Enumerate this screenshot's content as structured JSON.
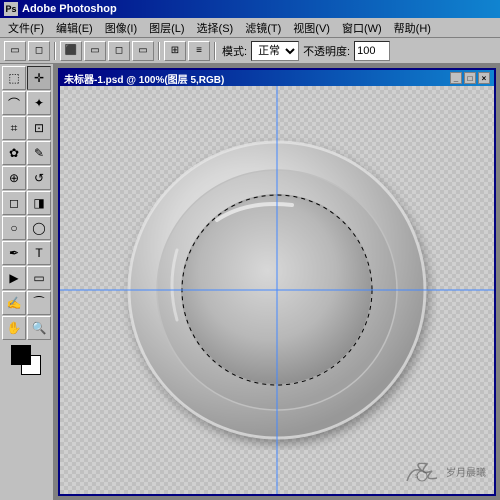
{
  "app": {
    "title": "Adobe Photoshop",
    "icon": "ps"
  },
  "menu": {
    "items": [
      "文件(F)",
      "编辑(E)",
      "图像(I)",
      "图层(L)",
      "选择(S)",
      "滤镜(T)",
      "视图(V)",
      "窗口(W)",
      "帮助(H)"
    ]
  },
  "toolbar": {
    "mode_label": "模式:",
    "mode_value": "正常",
    "opacity_label": "不透明度:",
    "opacity_value": "100"
  },
  "doc": {
    "title": "未标器-1.psd @ 100%(图层 5,RGB)",
    "close": "×",
    "minimize": "_",
    "restore": "□"
  },
  "tools": [
    {
      "name": "rectangular-marquee",
      "icon": "⬚"
    },
    {
      "name": "move",
      "icon": "✛"
    },
    {
      "name": "lasso",
      "icon": "⌒"
    },
    {
      "name": "polygon-lasso",
      "icon": "⬟"
    },
    {
      "name": "magic-wand",
      "icon": "✦"
    },
    {
      "name": "crop",
      "icon": "⌗"
    },
    {
      "name": "slice",
      "icon": "⊡"
    },
    {
      "name": "healing-brush",
      "icon": "✿"
    },
    {
      "name": "brush",
      "icon": "✎"
    },
    {
      "name": "clone-stamp",
      "icon": "⊕"
    },
    {
      "name": "history-brush",
      "icon": "↺"
    },
    {
      "name": "eraser",
      "icon": "◻"
    },
    {
      "name": "gradient",
      "icon": "◨"
    },
    {
      "name": "blur",
      "icon": "○"
    },
    {
      "name": "dodge",
      "icon": "◯"
    },
    {
      "name": "pen",
      "icon": "✒"
    },
    {
      "name": "type",
      "icon": "T"
    },
    {
      "name": "path-selection",
      "icon": "▶"
    },
    {
      "name": "shape",
      "icon": "◻"
    },
    {
      "name": "notes",
      "icon": "✍"
    },
    {
      "name": "eyedropper",
      "icon": "⁀"
    },
    {
      "name": "hand",
      "icon": "✋"
    },
    {
      "name": "zoom",
      "icon": "⊕"
    }
  ],
  "watermark": {
    "text": "岁月晨曦"
  },
  "colors": {
    "title_bar_start": "#000080",
    "title_bar_end": "#1084d0",
    "canvas_bg": "#808080",
    "doc_border": "#000080",
    "crosshair": "#4488ff"
  }
}
